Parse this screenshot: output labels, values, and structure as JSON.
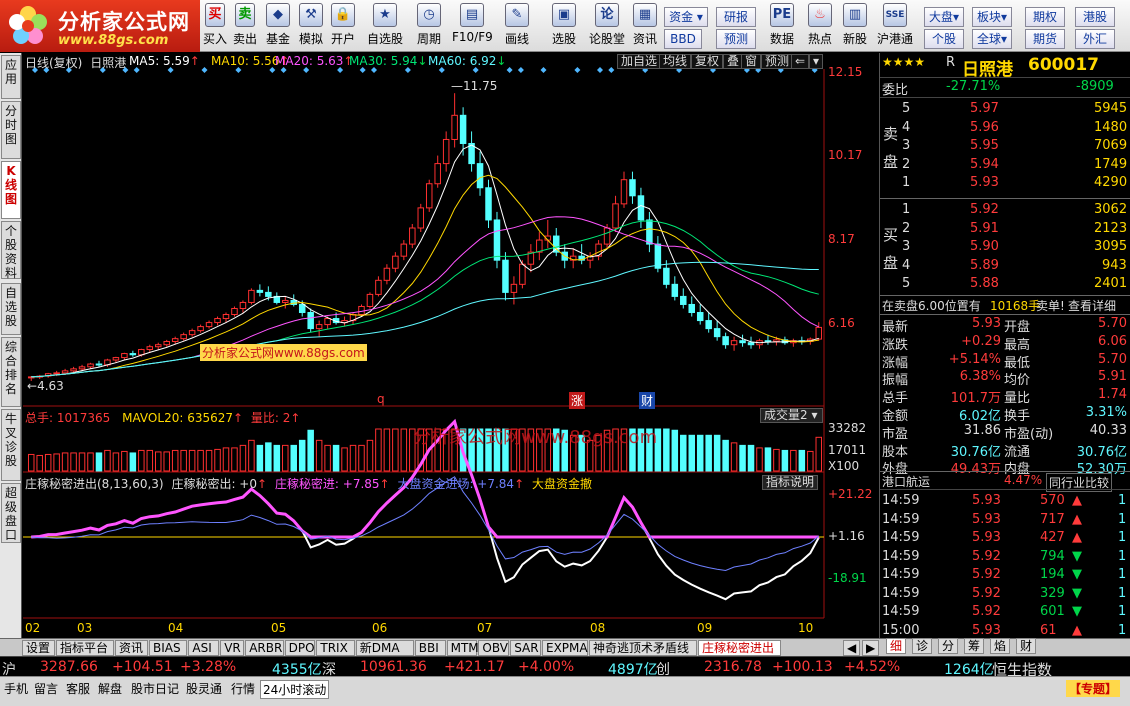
{
  "brand": {
    "name": "分析家公式网",
    "url": "www.88gs.com"
  },
  "toolbar": {
    "buy": "买入",
    "sell": "卖出",
    "fund": "基金",
    "sim": "模拟",
    "open": "开户",
    "watch": "自选股",
    "period": "周期",
    "f10": "F10/F9",
    "draw": "画线",
    "pick": "选股",
    "forum": "论股堂",
    "news": "资讯",
    "data": "数据",
    "hot": "热点",
    "newstock": "新股",
    "hk": "沪港通"
  },
  "toolbar_right": {
    "r1": [
      "资金",
      "研报",
      "大盘",
      "板块",
      "期权",
      "港股"
    ],
    "r2": [
      "BBD",
      "预测",
      "个股",
      "全球",
      "期货",
      "外汇"
    ]
  },
  "left_tabs": [
    "应用",
    "分时图",
    "K线图",
    "个股资料",
    "自选股",
    "综合排名",
    "牛叉诊股",
    "超级盘口"
  ],
  "chart": {
    "title": "日线(复权)",
    "stock": "日照港",
    "ma": [
      {
        "label": "MA5: 5.59",
        "color": "#ffffff"
      },
      {
        "label": "MA10: 5.56",
        "color": "#ffd800"
      },
      {
        "label": "MA20: 5.63",
        "color": "#ff55ff"
      },
      {
        "label": "MA30: 5.94",
        "color": "#00e676"
      },
      {
        "label": "MA60: 6.92",
        "color": "#5ff7ff"
      }
    ],
    "menu": [
      "加自选",
      "均线",
      "复权",
      "叠",
      "窗",
      "预测"
    ],
    "price_ticks": [
      "12.15",
      "10.17",
      "8.17",
      "6.16"
    ],
    "high_label": "11.75",
    "low_label": "4.63",
    "markers": [
      "q",
      "涨",
      "财"
    ],
    "watermark": "分析家公式网www.88gs.com",
    "vol_header": {
      "total": "总手: 1017365",
      "mavol": "MAVOL20: 635627",
      "ratio": "量比: 2"
    },
    "vol_button": "成交量2",
    "vol_ticks": [
      "33282",
      "17011",
      "X100"
    ],
    "vol_watermark": "分析家公式网www.88gs.com",
    "ind_header": {
      "name": "庄稼秘密进出(8,13,60,3)",
      "a": "庄稼秘密出: +0",
      "b": "庄稼秘密进: +7.85",
      "c": "大盘资金进场: +7.84",
      "d": "大盘资金撤"
    },
    "ind_button": "指标说明",
    "ind_ticks": [
      "+21.22",
      "+1.16",
      "-18.91"
    ],
    "months": [
      "02",
      "03",
      "04",
      "05",
      "06",
      "07",
      "08",
      "09",
      "10"
    ]
  },
  "chart_data": {
    "type": "candlestick",
    "ylim": [
      4.3,
      12.5
    ],
    "ohlc": [
      [
        4.68,
        4.72,
        4.6,
        4.7
      ],
      [
        4.7,
        4.75,
        4.65,
        4.72
      ],
      [
        4.72,
        4.8,
        4.68,
        4.78
      ],
      [
        4.78,
        4.85,
        4.72,
        4.8
      ],
      [
        4.8,
        4.9,
        4.75,
        4.85
      ],
      [
        4.85,
        4.95,
        4.8,
        4.9
      ],
      [
        4.9,
        5.0,
        4.85,
        4.95
      ],
      [
        4.95,
        5.05,
        4.9,
        5.02
      ],
      [
        5.02,
        5.1,
        4.95,
        5.0
      ],
      [
        5.0,
        5.15,
        4.95,
        5.12
      ],
      [
        5.12,
        5.2,
        5.05,
        5.18
      ],
      [
        5.18,
        5.3,
        5.12,
        5.28
      ],
      [
        5.28,
        5.35,
        5.2,
        5.25
      ],
      [
        5.25,
        5.4,
        5.2,
        5.38
      ],
      [
        5.38,
        5.5,
        5.3,
        5.45
      ],
      [
        5.45,
        5.55,
        5.38,
        5.5
      ],
      [
        5.5,
        5.62,
        5.45,
        5.58
      ],
      [
        5.58,
        5.7,
        5.5,
        5.65
      ],
      [
        5.65,
        5.8,
        5.6,
        5.75
      ],
      [
        5.75,
        5.9,
        5.7,
        5.85
      ],
      [
        5.85,
        6.0,
        5.8,
        5.95
      ],
      [
        5.95,
        6.1,
        5.9,
        6.05
      ],
      [
        6.05,
        6.2,
        5.98,
        6.15
      ],
      [
        6.15,
        6.3,
        6.05,
        6.25
      ],
      [
        6.25,
        6.45,
        6.2,
        6.4
      ],
      [
        6.4,
        6.6,
        6.3,
        6.55
      ],
      [
        6.55,
        6.9,
        6.5,
        6.85
      ],
      [
        6.85,
        7.0,
        6.7,
        6.8
      ],
      [
        6.8,
        6.95,
        6.6,
        6.7
      ],
      [
        6.7,
        6.8,
        6.5,
        6.55
      ],
      [
        6.55,
        6.7,
        6.4,
        6.6
      ],
      [
        6.6,
        6.75,
        6.45,
        6.5
      ],
      [
        6.5,
        6.6,
        6.2,
        6.3
      ],
      [
        6.3,
        6.4,
        5.8,
        5.9
      ],
      [
        5.9,
        6.1,
        5.7,
        6.0
      ],
      [
        6.0,
        6.2,
        5.9,
        6.15
      ],
      [
        6.15,
        6.3,
        6.0,
        6.05
      ],
      [
        6.05,
        6.2,
        5.95,
        6.1
      ],
      [
        6.1,
        6.3,
        6.0,
        6.25
      ],
      [
        6.25,
        6.5,
        6.2,
        6.45
      ],
      [
        6.45,
        6.8,
        6.4,
        6.75
      ],
      [
        6.75,
        7.2,
        6.7,
        7.1
      ],
      [
        7.1,
        7.5,
        7.0,
        7.4
      ],
      [
        7.4,
        7.8,
        7.3,
        7.7
      ],
      [
        7.7,
        8.1,
        7.6,
        8.0
      ],
      [
        8.0,
        8.5,
        7.9,
        8.4
      ],
      [
        8.4,
        9.0,
        8.3,
        8.9
      ],
      [
        8.9,
        9.6,
        8.8,
        9.5
      ],
      [
        9.5,
        10.2,
        9.4,
        10.0
      ],
      [
        10.0,
        10.8,
        9.8,
        10.6
      ],
      [
        10.6,
        11.75,
        10.4,
        11.2
      ],
      [
        11.2,
        11.4,
        10.2,
        10.5
      ],
      [
        10.5,
        10.8,
        9.8,
        10.0
      ],
      [
        10.0,
        10.3,
        9.2,
        9.4
      ],
      [
        9.4,
        9.6,
        8.4,
        8.6
      ],
      [
        8.6,
        8.8,
        7.4,
        7.6
      ],
      [
        7.6,
        7.8,
        6.6,
        6.8
      ],
      [
        6.8,
        7.2,
        6.5,
        7.0
      ],
      [
        7.0,
        7.6,
        6.9,
        7.5
      ],
      [
        7.5,
        8.0,
        7.3,
        7.8
      ],
      [
        7.8,
        8.3,
        7.6,
        8.1
      ],
      [
        8.1,
        8.6,
        7.9,
        8.2
      ],
      [
        8.2,
        8.4,
        7.7,
        7.8
      ],
      [
        7.8,
        8.0,
        7.4,
        7.6
      ],
      [
        7.6,
        7.9,
        7.4,
        7.7
      ],
      [
        7.7,
        8.0,
        7.5,
        7.6
      ],
      [
        7.6,
        7.8,
        7.4,
        7.7
      ],
      [
        7.7,
        8.1,
        7.6,
        8.0
      ],
      [
        8.0,
        8.5,
        7.9,
        8.4
      ],
      [
        8.4,
        9.2,
        8.3,
        9.0
      ],
      [
        9.0,
        9.8,
        8.9,
        9.6
      ],
      [
        9.6,
        9.8,
        9.0,
        9.2
      ],
      [
        9.2,
        9.4,
        8.4,
        8.6
      ],
      [
        8.6,
        8.8,
        7.8,
        8.0
      ],
      [
        8.0,
        8.2,
        7.3,
        7.4
      ],
      [
        7.4,
        7.6,
        6.9,
        7.0
      ],
      [
        7.0,
        7.2,
        6.6,
        6.7
      ],
      [
        6.7,
        6.9,
        6.4,
        6.5
      ],
      [
        6.5,
        6.7,
        6.2,
        6.3
      ],
      [
        6.3,
        6.5,
        6.0,
        6.1
      ],
      [
        6.1,
        6.3,
        5.8,
        5.9
      ],
      [
        5.9,
        6.1,
        5.6,
        5.7
      ],
      [
        5.7,
        5.8,
        5.4,
        5.5
      ],
      [
        5.5,
        5.7,
        5.35,
        5.6
      ],
      [
        5.6,
        5.75,
        5.45,
        5.55
      ],
      [
        5.55,
        5.7,
        5.4,
        5.5
      ],
      [
        5.5,
        5.65,
        5.4,
        5.6
      ],
      [
        5.6,
        5.75,
        5.5,
        5.58
      ],
      [
        5.58,
        5.7,
        5.48,
        5.62
      ],
      [
        5.62,
        5.7,
        5.5,
        5.55
      ],
      [
        5.55,
        5.65,
        5.45,
        5.6
      ],
      [
        5.6,
        5.7,
        5.5,
        5.58
      ],
      [
        5.58,
        5.68,
        5.5,
        5.64
      ],
      [
        5.64,
        6.06,
        5.6,
        5.93
      ]
    ]
  },
  "quote": {
    "stars": "★★★★",
    "r": "R",
    "name": "日照港",
    "code": "600017",
    "webi": {
      "label": "委比",
      "pct": "-27.71%",
      "diff": "-8909"
    },
    "sell_label": "卖盘",
    "buy_label": "买盘",
    "asks": [
      [
        "5",
        "5.97",
        "5945"
      ],
      [
        "4",
        "5.96",
        "1480"
      ],
      [
        "3",
        "5.95",
        "7069"
      ],
      [
        "2",
        "5.94",
        "1749"
      ],
      [
        "1",
        "5.93",
        "4290"
      ]
    ],
    "bids": [
      [
        "1",
        "5.92",
        "3062"
      ],
      [
        "2",
        "5.91",
        "2123"
      ],
      [
        "3",
        "5.90",
        "3095"
      ],
      [
        "4",
        "5.89",
        "943"
      ],
      [
        "5",
        "5.88",
        "2401"
      ]
    ],
    "notice": {
      "a": "在卖盘6.00位置有",
      "b": "10168手",
      "c": "卖单!",
      "d": "查看详细"
    },
    "stats": [
      [
        "最新",
        "5.93",
        "开盘",
        "5.70"
      ],
      [
        "涨跌",
        "+0.29",
        "最高",
        "6.06"
      ],
      [
        "涨幅",
        "+5.14%",
        "最低",
        "5.70"
      ],
      [
        "振幅",
        "6.38%",
        "均价",
        "5.91"
      ],
      [
        "总手",
        "101.7万",
        "量比",
        "1.74"
      ],
      [
        "金额",
        "6.02亿",
        "换手",
        "3.31%"
      ],
      [
        "市盈",
        "31.86",
        "市盈(动)",
        "40.33"
      ],
      [
        "股本",
        "30.76亿",
        "流通",
        "30.76亿"
      ],
      [
        "外盘",
        "49.43万",
        "内盘",
        "52.30万"
      ]
    ],
    "sector": {
      "name": "港口航运",
      "pct": "4.47%",
      "btn": "同行业比较"
    },
    "ticks": [
      [
        "14:59",
        "5.93",
        "570",
        "1"
      ],
      [
        "14:59",
        "5.93",
        "717",
        "1"
      ],
      [
        "14:59",
        "5.93",
        "427",
        "1"
      ],
      [
        "14:59",
        "5.92",
        "794",
        "1"
      ],
      [
        "14:59",
        "5.92",
        "194",
        "1"
      ],
      [
        "14:59",
        "5.92",
        "329",
        "1"
      ],
      [
        "14:59",
        "5.92",
        "601",
        "1"
      ],
      [
        "15:00",
        "5.93",
        "61",
        "1"
      ]
    ],
    "tick_dirs": [
      "up",
      "up",
      "up",
      "down",
      "down",
      "down",
      "down",
      "up"
    ],
    "bottom_tabs": [
      "细",
      "诊",
      "分",
      "筹",
      "焰",
      "财"
    ]
  },
  "tabs": [
    "设置",
    "指标平台",
    "资讯",
    "BIAS",
    "ASI",
    "VR",
    "ARBR",
    "DPO",
    "TRIX",
    "新DMA",
    "BBI",
    "MTM",
    "OBV",
    "SAR",
    "EXPMA",
    "神奇逃顶术矛盾线",
    "庄稼秘密进出"
  ],
  "indices": {
    "sh": {
      "n": "沪",
      "v": "3287.66",
      "c": "+104.51",
      "p": "+3.28%",
      "a": "4355亿"
    },
    "sz": {
      "n": "深",
      "v": "10961.36",
      "c": "+421.17",
      "p": "+4.00%",
      "a": "4897亿"
    },
    "cy": {
      "n": "创",
      "v": "2316.78",
      "c": "+100.13",
      "p": "+4.52%",
      "a": "1264亿"
    },
    "hs": "恒生指数"
  },
  "status": [
    "手机",
    "留言",
    "客服",
    "解盘",
    "股市日记",
    "股灵通",
    "行情",
    "24小时滚动"
  ],
  "special": "【专题】"
}
